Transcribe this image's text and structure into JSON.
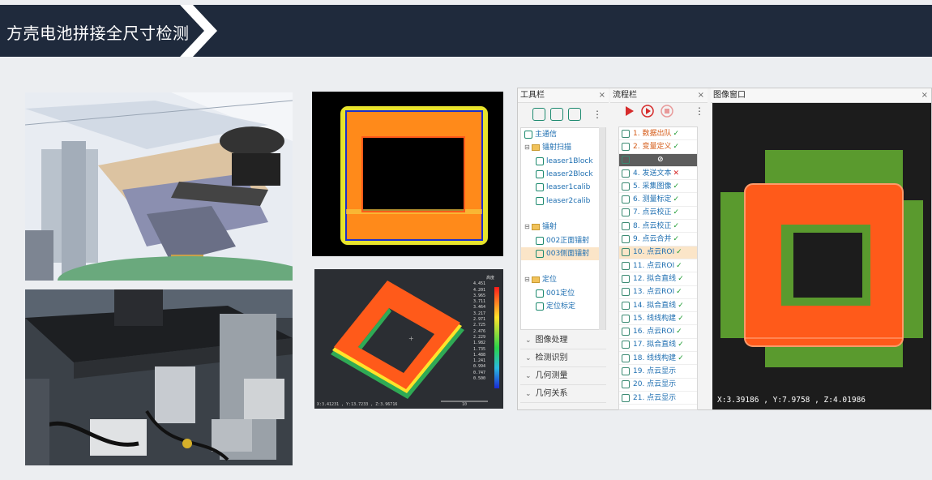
{
  "header": {
    "title": "方壳电池拼接全尺寸检测"
  },
  "colors": {
    "banner": "#1f2a3c",
    "accent_green": "#1d8a6f",
    "orange_scan": "#ff5a1a",
    "green_scan": "#5a9a2e"
  },
  "toolbar_pane": {
    "title": "工具栏",
    "close": "×",
    "tree": [
      {
        "label": "主通信",
        "type": "item",
        "indent": 0
      },
      {
        "label": "镭射扫描",
        "type": "folder",
        "indent": 0
      },
      {
        "label": "leaser1Block",
        "type": "item",
        "indent": 1
      },
      {
        "label": "leaser2Block",
        "type": "item",
        "indent": 1
      },
      {
        "label": "leaser1calib",
        "type": "item",
        "indent": 1
      },
      {
        "label": "leaser2calib",
        "type": "item",
        "indent": 1
      },
      {
        "label": "",
        "type": "blank",
        "indent": 0
      },
      {
        "label": "镭射",
        "type": "folder",
        "indent": 0
      },
      {
        "label": "002正面镭射",
        "type": "item",
        "indent": 1
      },
      {
        "label": "003侧面镭射",
        "type": "item",
        "indent": 1,
        "selected": true
      },
      {
        "label": "",
        "type": "blank",
        "indent": 0
      },
      {
        "label": "定位",
        "type": "folder",
        "indent": 0
      },
      {
        "label": "001定位",
        "type": "item",
        "indent": 1
      },
      {
        "label": "定位标定",
        "type": "item",
        "indent": 1
      }
    ],
    "categories": [
      "图像处理",
      "检测识别",
      "几何测量",
      "几何关系"
    ]
  },
  "flow_pane": {
    "title": "流程栏",
    "close": "×",
    "items": [
      {
        "label": "1. 数据出队",
        "status": "✓",
        "style": "red"
      },
      {
        "label": "2. 变量定义",
        "status": "✓",
        "style": "red"
      },
      {
        "label": "",
        "status": "⊘",
        "style": "dark"
      },
      {
        "label": "4. 发送文本",
        "status": "✕",
        "style": ""
      },
      {
        "label": "5. 采集图像",
        "status": "✓",
        "style": ""
      },
      {
        "label": "6. 测量标定",
        "status": "✓",
        "style": ""
      },
      {
        "label": "7. 点云校正",
        "status": "✓",
        "style": ""
      },
      {
        "label": "8. 点云校正",
        "status": "✓",
        "style": ""
      },
      {
        "label": "9. 点云合并",
        "status": "✓",
        "style": ""
      },
      {
        "label": "10. 点云ROI",
        "status": "✓",
        "style": "hl"
      },
      {
        "label": "11. 点云ROI",
        "status": "✓",
        "style": ""
      },
      {
        "label": "12. 拟合直线",
        "status": "✓",
        "style": ""
      },
      {
        "label": "13. 点云ROI",
        "status": "✓",
        "style": ""
      },
      {
        "label": "14. 拟合直线",
        "status": "✓",
        "style": ""
      },
      {
        "label": "15. 线线构建",
        "status": "✓",
        "style": ""
      },
      {
        "label": "16. 点云ROI",
        "status": "✓",
        "style": ""
      },
      {
        "label": "17. 拟合直线",
        "status": "✓",
        "style": ""
      },
      {
        "label": "18. 线线构建",
        "status": "✓",
        "style": ""
      },
      {
        "label": "19. 点云显示",
        "status": "",
        "style": ""
      },
      {
        "label": "20. 点云显示",
        "status": "",
        "style": ""
      },
      {
        "label": "21. 点云显示",
        "status": "",
        "style": ""
      }
    ]
  },
  "image_window": {
    "title": "图像窗口",
    "close": "×",
    "coords": "X:3.39186 , Y:7.9758 , Z:4.01986"
  },
  "scan2": {
    "legend_title": "高度",
    "legend_values": [
      "4.451",
      "4.201",
      "3.965",
      "3.711",
      "3.464",
      "3.217",
      "2.971",
      "2.725",
      "2.476",
      "2.229",
      "1.982",
      "1.735",
      "1.488",
      "1.241",
      "0.994",
      "0.747",
      "0.500"
    ],
    "coords": "X:3.41231 , Y:13.7233 , Z:3.96716",
    "scale": "10"
  }
}
